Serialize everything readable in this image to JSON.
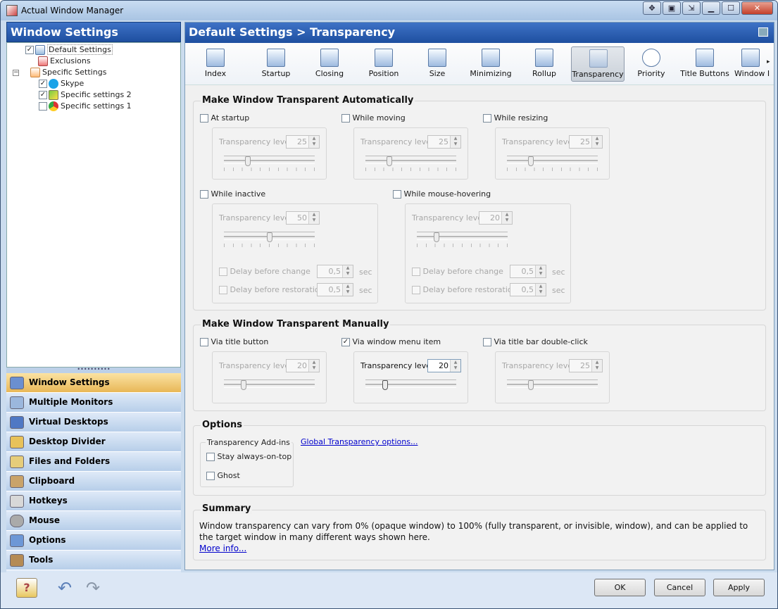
{
  "window": {
    "title": "Actual Window Manager"
  },
  "titlebar_buttons": [
    "✥",
    "▣",
    "⇲",
    "▁",
    "☐",
    "✕"
  ],
  "left": {
    "header": "Window Settings",
    "tree": [
      {
        "label": "Default Settings",
        "checked": true,
        "icon": "default-settings-icon"
      },
      {
        "label": "Exclusions",
        "icon": "exclusions-icon"
      },
      {
        "label": "Specific Settings",
        "icon": "specific-settings-icon"
      },
      {
        "label": "Skype",
        "checked": true,
        "icon": "skype-icon"
      },
      {
        "label": "Specific settings 2",
        "checked": true,
        "icon": "chart-icon"
      },
      {
        "label": "Specific settings 1",
        "checked": false,
        "icon": "chrome-icon"
      }
    ],
    "nav": [
      {
        "label": "Window Settings",
        "active": true
      },
      {
        "label": "Multiple Monitors"
      },
      {
        "label": "Virtual Desktops"
      },
      {
        "label": "Desktop Divider"
      },
      {
        "label": "Files and Folders"
      },
      {
        "label": "Clipboard"
      },
      {
        "label": "Hotkeys"
      },
      {
        "label": "Mouse"
      },
      {
        "label": "Options"
      },
      {
        "label": "Tools"
      }
    ],
    "more": "»"
  },
  "right": {
    "header": "Default Settings > Transparency",
    "toolbar": [
      {
        "label": "Index"
      },
      {
        "label": "Startup"
      },
      {
        "label": "Closing"
      },
      {
        "label": "Position"
      },
      {
        "label": "Size"
      },
      {
        "label": "Minimizing"
      },
      {
        "label": "Rollup"
      },
      {
        "label": "Transparency",
        "active": true
      },
      {
        "label": "Priority"
      },
      {
        "label": "Title Buttons"
      },
      {
        "label": "Window I"
      }
    ],
    "auto": {
      "title": "Make Window Transparent Automatically",
      "level_label": "Transparency level",
      "sec": "sec",
      "delay_change": "Delay before change",
      "delay_restore": "Delay before restoration",
      "items": [
        {
          "label": "At startup",
          "checked": false,
          "value": "25",
          "level": 0.25
        },
        {
          "label": "While moving",
          "checked": false,
          "value": "25",
          "level": 0.25
        },
        {
          "label": "While resizing",
          "checked": false,
          "value": "25",
          "level": 0.25
        },
        {
          "label": "While inactive",
          "checked": false,
          "value": "50",
          "level": 0.5,
          "delay_change": "0,5",
          "delay_restore": "0,5"
        },
        {
          "label": "While mouse-hovering",
          "checked": false,
          "value": "20",
          "level": 0.2,
          "delay_change": "0,5",
          "delay_restore": "0,5"
        }
      ]
    },
    "manual": {
      "title": "Make Window Transparent Manually",
      "level_label": "Transparency level",
      "items": [
        {
          "label": "Via title button",
          "checked": false,
          "value": "20",
          "level": 0.2
        },
        {
          "label": "Via window menu item",
          "checked": true,
          "value": "20",
          "level": 0.2
        },
        {
          "label": "Via title bar double-click",
          "checked": false,
          "value": "25",
          "level": 0.25
        }
      ]
    },
    "options": {
      "title": "Options",
      "addins_title": "Transparency Add-ins",
      "stay_on_top": "Stay always-on-top",
      "ghost": "Ghost",
      "global_link": "Global Transparency options..."
    },
    "summary": {
      "title": "Summary",
      "text": "Window transparency can vary from 0% (opaque window) to 100% (fully transparent, or invisible, window), and can be applied to the target window in many different ways shown here.",
      "more": "More info..."
    }
  },
  "buttons": {
    "ok": "OK",
    "cancel": "Cancel",
    "apply": "Apply"
  },
  "colors": {
    "accent": "#1e4fa0",
    "active_nav": "#e8b757",
    "link": "#0000cc"
  }
}
